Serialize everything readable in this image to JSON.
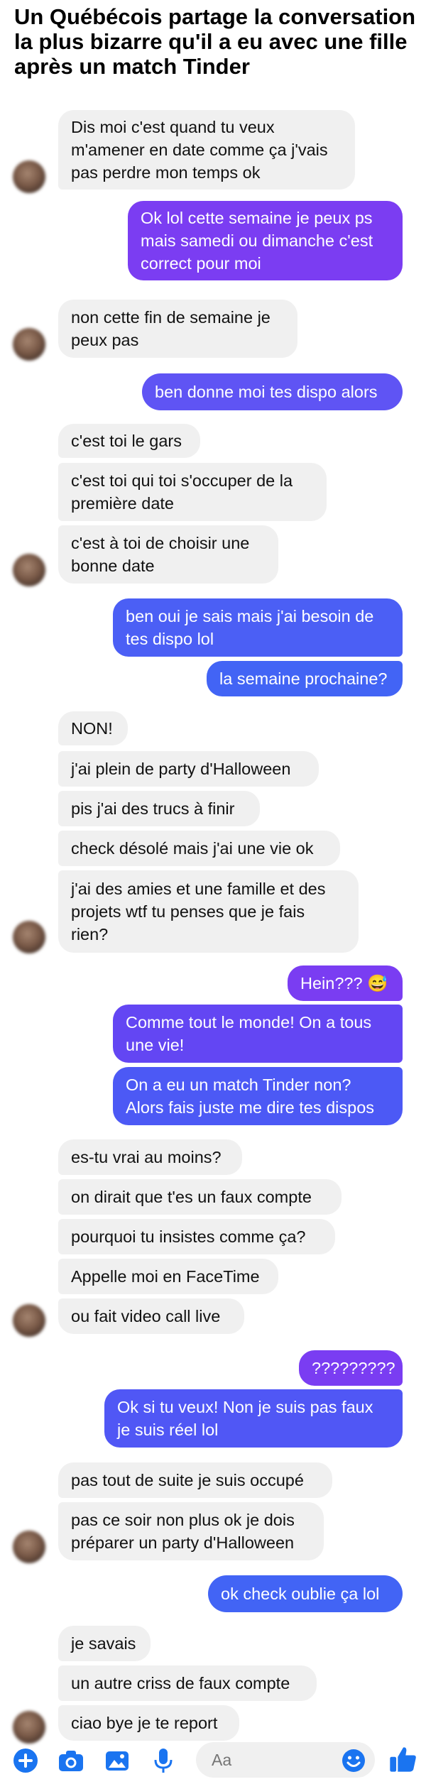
{
  "headline": "Un Québécois partage la conversation la plus bizarre qu'il a eu avec une fille après un match Tinder",
  "colors": {
    "incoming_bg": "#f0f0f0",
    "outgoing_purple": "#7b3df2",
    "outgoing_blue": "#4264f5",
    "accent": "#1a74f0"
  },
  "messages": [
    {
      "from": "her",
      "text": "Dis moi c'est quand tu veux\nm'amener en date comme ça j'vais\npas perdre mon temps ok"
    },
    {
      "from": "me",
      "text": "Ok lol cette semaine je peux ps\nmais samedi ou dimanche c'est\ncorrect pour moi"
    },
    {
      "from": "her",
      "text": "non cette fin de semaine je\npeux pas"
    },
    {
      "from": "me",
      "text": "ben donne moi tes dispo alors"
    },
    {
      "from": "her",
      "text": "c'est toi le gars"
    },
    {
      "from": "her",
      "text": "c'est toi qui toi s'occuper de la\npremière date"
    },
    {
      "from": "her",
      "text": "c'est à toi de choisir une\nbonne date"
    },
    {
      "from": "me",
      "text": "ben oui je sais mais j'ai besoin de\ntes dispo lol"
    },
    {
      "from": "me",
      "text": "la semaine prochaine?"
    },
    {
      "from": "her",
      "text": "NON!"
    },
    {
      "from": "her",
      "text": "j'ai plein de party d'Halloween"
    },
    {
      "from": "her",
      "text": "pis j'ai des trucs à finir"
    },
    {
      "from": "her",
      "text": "check désolé mais j'ai une vie ok"
    },
    {
      "from": "her",
      "text": "j'ai des amies et une famille et des\nprojets wtf tu penses que je fais\nrien?"
    },
    {
      "from": "me",
      "text": "Hein??? 😅"
    },
    {
      "from": "me",
      "text": "Comme tout le monde! On a tous\nune vie!"
    },
    {
      "from": "me",
      "text": "On a eu un match Tinder non?\nAlors fais juste me dire tes dispos"
    },
    {
      "from": "her",
      "text": "es-tu vrai au moins?"
    },
    {
      "from": "her",
      "text": "on dirait que t'es un faux compte"
    },
    {
      "from": "her",
      "text": "pourquoi tu insistes comme ça?"
    },
    {
      "from": "her",
      "text": "Appelle moi en FaceTime"
    },
    {
      "from": "her",
      "text": "ou fait video call live"
    },
    {
      "from": "me",
      "text": "?????????"
    },
    {
      "from": "me",
      "text": "Ok si tu veux! Non je suis pas faux\nje suis réel lol"
    },
    {
      "from": "her",
      "text": "pas tout de suite je suis occupé"
    },
    {
      "from": "her",
      "text": "pas ce soir non plus ok je dois\npréparer un party d'Halloween"
    },
    {
      "from": "me",
      "text": "ok check oublie ça lol"
    },
    {
      "from": "her",
      "text": "je savais"
    },
    {
      "from": "her",
      "text": "un autre criss de faux compte"
    },
    {
      "from": "her",
      "text": "ciao bye je te report"
    }
  ],
  "composer": {
    "placeholder": "Aa",
    "icons": [
      "plus-icon",
      "camera-icon",
      "image-icon",
      "microphone-icon",
      "emoji-icon",
      "thumbs-up-icon"
    ]
  }
}
